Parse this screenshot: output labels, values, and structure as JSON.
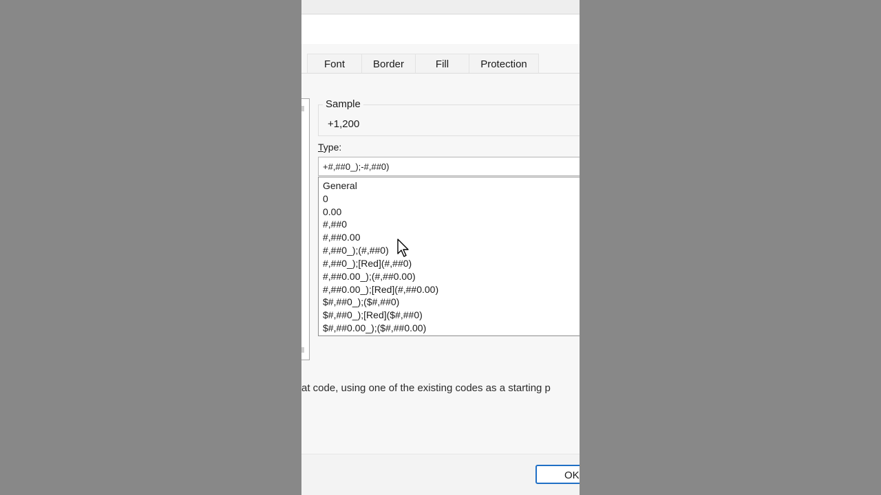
{
  "dialog": {
    "tabs": [
      "Font",
      "Border",
      "Fill",
      "Protection"
    ],
    "sample": {
      "label": "Sample",
      "value": "+1,200"
    },
    "type": {
      "label_prefix": "T",
      "label_rest": "ype:",
      "value": "+#,##0_);-#,##0)"
    },
    "format_list": [
      "General",
      "0",
      "0.00",
      "#,##0",
      "#,##0.00",
      "#,##0_);(#,##0)",
      "#,##0_);[Red](#,##0)",
      "#,##0.00_);(#,##0.00)",
      "#,##0.00_);[Red](#,##0.00)",
      "$#,##0_);($#,##0)",
      "$#,##0_);[Red]($#,##0)",
      "$#,##0.00_);($#,##0.00)"
    ],
    "hint": "at code, using one of the existing codes as a starting p",
    "ok_label": "OK",
    "icons": {
      "cursor": "mouse-pointer-icon"
    }
  }
}
